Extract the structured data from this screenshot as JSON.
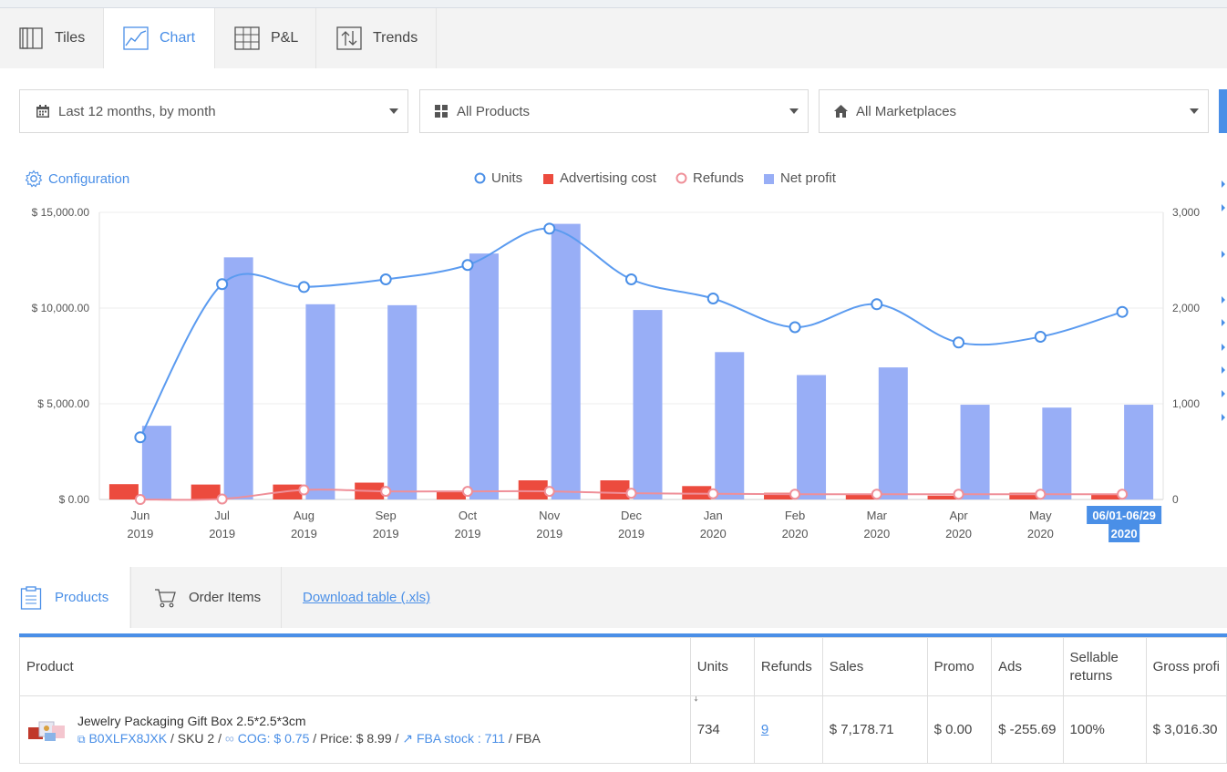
{
  "tabs": [
    {
      "label": "Tiles",
      "icon": "tiles-icon"
    },
    {
      "label": "Chart",
      "icon": "line-chart-icon"
    },
    {
      "label": "P&L",
      "icon": "grid-table-icon"
    },
    {
      "label": "Trends",
      "icon": "trends-arrows-icon"
    }
  ],
  "filters": {
    "period": "Last 12 months, by month",
    "products": "All Products",
    "marketplaces": "All Marketplaces"
  },
  "configuration_label": "Configuration",
  "legend": {
    "units": "Units",
    "ads": "Advertising cost",
    "refunds": "Refunds",
    "net": "Net profit"
  },
  "colors": {
    "accent": "#4a8fe7",
    "units_line": "#5b9bf0",
    "ads_bar": "#ec4b3e",
    "refunds_line": "#ef8f98",
    "net_bar": "#98aef6"
  },
  "chart_data": {
    "type": "bar",
    "categories": [
      [
        "Jun",
        "2019"
      ],
      [
        "Jul",
        "2019"
      ],
      [
        "Aug",
        "2019"
      ],
      [
        "Sep",
        "2019"
      ],
      [
        "Oct",
        "2019"
      ],
      [
        "Nov",
        "2019"
      ],
      [
        "Dec",
        "2019"
      ],
      [
        "Jan",
        "2020"
      ],
      [
        "Feb",
        "2020"
      ],
      [
        "Mar",
        "2020"
      ],
      [
        "Apr",
        "2020"
      ],
      [
        "May",
        "2020"
      ],
      [
        "06/01-06/29",
        "2020"
      ]
    ],
    "highlight_last_category": true,
    "left_axis": {
      "ticks": [
        "$ 0.00",
        "$ 5,000.00",
        "$ 10,000.00",
        "$ 15,000.00"
      ],
      "range": [
        0,
        15000
      ]
    },
    "right_axis": {
      "ticks": [
        "0",
        "1,000",
        "2,000",
        "3,000"
      ],
      "range": [
        0,
        3000
      ]
    },
    "grid": true,
    "series": [
      {
        "name": "Net profit",
        "kind": "bar",
        "axis": "left",
        "values": [
          3850,
          12650,
          10200,
          10150,
          12850,
          14400,
          9900,
          7700,
          6500,
          6900,
          4950,
          4800,
          4950
        ]
      },
      {
        "name": "Advertising cost",
        "kind": "bar",
        "axis": "left",
        "values": [
          800,
          780,
          780,
          880,
          450,
          1000,
          1000,
          700,
          350,
          300,
          200,
          350,
          300
        ]
      },
      {
        "name": "Units",
        "kind": "line",
        "axis": "right",
        "values": [
          650,
          2250,
          2220,
          2300,
          2450,
          2830,
          2300,
          2100,
          1800,
          2040,
          1640,
          1700,
          1960
        ]
      },
      {
        "name": "Refunds",
        "kind": "line",
        "axis": "right",
        "values": [
          0,
          5,
          100,
          85,
          85,
          85,
          65,
          60,
          55,
          55,
          55,
          55,
          55
        ]
      }
    ]
  },
  "lower_tabs": {
    "products": "Products",
    "order_items": "Order Items",
    "download": "Download table (.xls)"
  },
  "table": {
    "headers": [
      "Product",
      "Units",
      "Refunds",
      "Sales",
      "Promo",
      "Ads",
      "Sellable returns",
      "Gross profi"
    ],
    "sort_indicator": "↓",
    "row": {
      "name": "Jewelry Packaging Gift Box 2.5*2.5*3cm",
      "asin": "B0XLFX8JXK",
      "sku": "/ SKU 2 /",
      "cog": "COG: $ 0.75",
      "price": "/ Price: $ 8.99 /",
      "fba_stock": "FBA stock : 711",
      "fulfilment": "/ FBA",
      "units": "734",
      "refunds": "9",
      "sales": "$ 7,178.71",
      "promo": "$ 0.00",
      "ads": "$ -255.69",
      "sellable_returns": "100%",
      "gross_profit": "$ 3,016.30"
    }
  }
}
